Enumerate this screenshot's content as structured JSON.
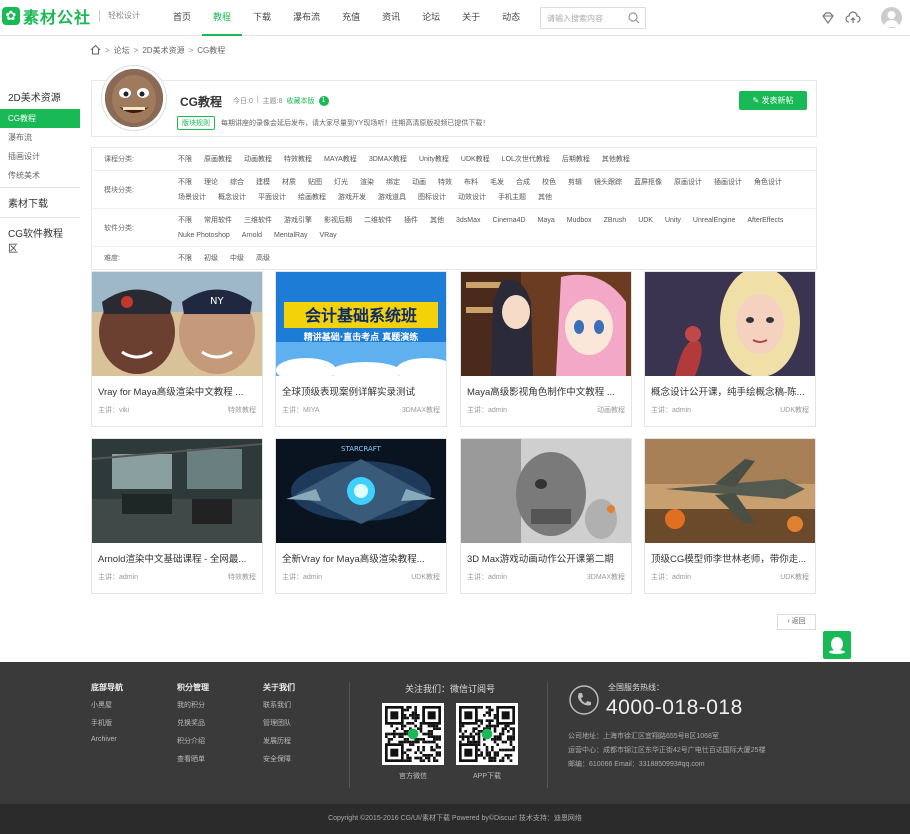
{
  "header": {
    "logo_mark": "✿",
    "logo_name": "素材公社",
    "slogan": "轻松设计",
    "nav": [
      "首页",
      "教程",
      "下载",
      "瀑布流",
      "充值",
      "资讯",
      "论坛",
      "关于",
      "动态"
    ],
    "active_nav": 1,
    "search_placeholder": "请输入搜索内容"
  },
  "breadcrumb": [
    "论坛",
    "2D美术资源",
    "CG教程"
  ],
  "sidebar": {
    "items": [
      {
        "label": "2D美术资源",
        "type": "h"
      },
      {
        "label": "CG教程",
        "type": "s",
        "active": true
      },
      {
        "label": "瀑布流",
        "type": "s"
      },
      {
        "label": "插画设计",
        "type": "s"
      },
      {
        "label": "传统美术",
        "type": "s"
      },
      {
        "label": "素材下载",
        "type": "h"
      },
      {
        "label": "CG软件教程区",
        "type": "h"
      }
    ]
  },
  "forum": {
    "title": "CG教程",
    "today": "今日:0",
    "divider": "|",
    "topics": "主题:8",
    "fav_label": "收藏本版",
    "fav_count": "1",
    "rule_tag": "版块规则",
    "rule_text": "每期讲座的录像会延后发布，请大家尽量到YY现场听！往期高清原版视频已提供下载！",
    "post_button": "发表新帖"
  },
  "filters": [
    {
      "label": "课程分类:",
      "options": [
        "不限",
        "原画教程",
        "动画教程",
        "特效教程",
        "MAYA教程",
        "3DMAX教程",
        "Unity教程",
        "UDK教程",
        "LOL次世代教程",
        "后期教程",
        "其他教程"
      ]
    },
    {
      "label": "模块分类:",
      "options": [
        "不限",
        "理论",
        "综合",
        "建模",
        "材质",
        "贴图",
        "灯光",
        "渲染",
        "绑定",
        "动画",
        "特效",
        "布料",
        "毛发",
        "合成",
        "校色",
        "剪辑",
        "镜头跟踪",
        "蓝屏抠像",
        "原画设计",
        "插画设计",
        "角色设计",
        "场景设计",
        "概念设计",
        "平面设计",
        "绘画教程",
        "游戏开发",
        "游戏道具",
        "图标设计",
        "动效设计",
        "手机主题",
        "其他"
      ]
    },
    {
      "label": "软件分类:",
      "options": [
        "不限",
        "常用软件",
        "三维软件",
        "游戏引擎",
        "影视后期",
        "二维软件",
        "插件",
        "其他",
        "3dsMax",
        "Cinema4D",
        "Maya",
        "Mudbox",
        "ZBrush",
        "UDK",
        "Unity",
        "UnrealEngine",
        "AfterEffects",
        "Nuke Photoshop",
        "Arnold",
        "MentalRay",
        "VRay"
      ]
    },
    {
      "label": "难度:",
      "options": [
        "不限",
        "初级",
        "中级",
        "高级"
      ]
    }
  ],
  "cards": [
    {
      "title": "Vray for Maya高级渲染中文教程 ...",
      "author": "主讲：viki",
      "category": "特效教程",
      "img": "baseball"
    },
    {
      "title": "全球顶级表现案例详解实录测试",
      "author": "主讲：MIYA",
      "category": "3DMAX教程",
      "img": "class"
    },
    {
      "title": "Maya高级影视角色制作中文教程 ...",
      "author": "主讲：admin",
      "category": "动画教程",
      "img": "anime"
    },
    {
      "title": "概念设计公开课，纯手绘概念稿-陈...",
      "author": "主讲：admin",
      "category": "UDK教程",
      "img": "portrait"
    },
    {
      "title": "Arnold渲染中文基础课程 - 全网最...",
      "author": "主讲：admin",
      "category": "特效教程",
      "img": "room"
    },
    {
      "title": "全新Vray for Maya高级渲染教程...",
      "author": "主讲：admin",
      "category": "UDK教程",
      "img": "ship"
    },
    {
      "title": "3D Max游戏动画动作公开课第二期",
      "author": "主讲：admin",
      "category": "3DMAX教程",
      "img": "robot"
    },
    {
      "title": "顶级CG模型师李世林老师，带你走...",
      "author": "主讲：admin",
      "category": "UDK教程",
      "img": "jet"
    }
  ],
  "class_banner": {
    "line1": "会计基础系统班",
    "line2": "精讲基础·直击考点 真题演练"
  },
  "back_button": "返回",
  "footer": {
    "cols": [
      {
        "title": "底部导航",
        "links": [
          "小黑屋",
          "手机版",
          "Archiver"
        ]
      },
      {
        "title": "积分管理",
        "links": [
          "我的积分",
          "兑换奖品",
          "积分介绍",
          "查看晒单"
        ]
      },
      {
        "title": "关于我们",
        "links": [
          "联系我们",
          "管理团队",
          "发展历程",
          "安全保障"
        ]
      }
    ],
    "follow_title": "关注我们：微信订阅号",
    "qr": [
      {
        "caption": "官方微信"
      },
      {
        "caption": "APP下载"
      }
    ],
    "hotline_label": "全国服务热线：",
    "hotline": "4000-018-018",
    "address": [
      "公司地址：上海市徐汇区宜翔路655号B区1068室",
      "运营中心：成都市锦江区东华正街42号广电仕百达国际大厦25楼",
      "邮编：610066 Email：3318850993#qq.com"
    ]
  },
  "copyright": "Copyright  ©2015-2016  CG/UI/素材下载  Powered by©Discuz!  技术支持：迪恩网络",
  "colors": {
    "accent": "#19b955",
    "footer_bg": "#3a3a3a"
  }
}
